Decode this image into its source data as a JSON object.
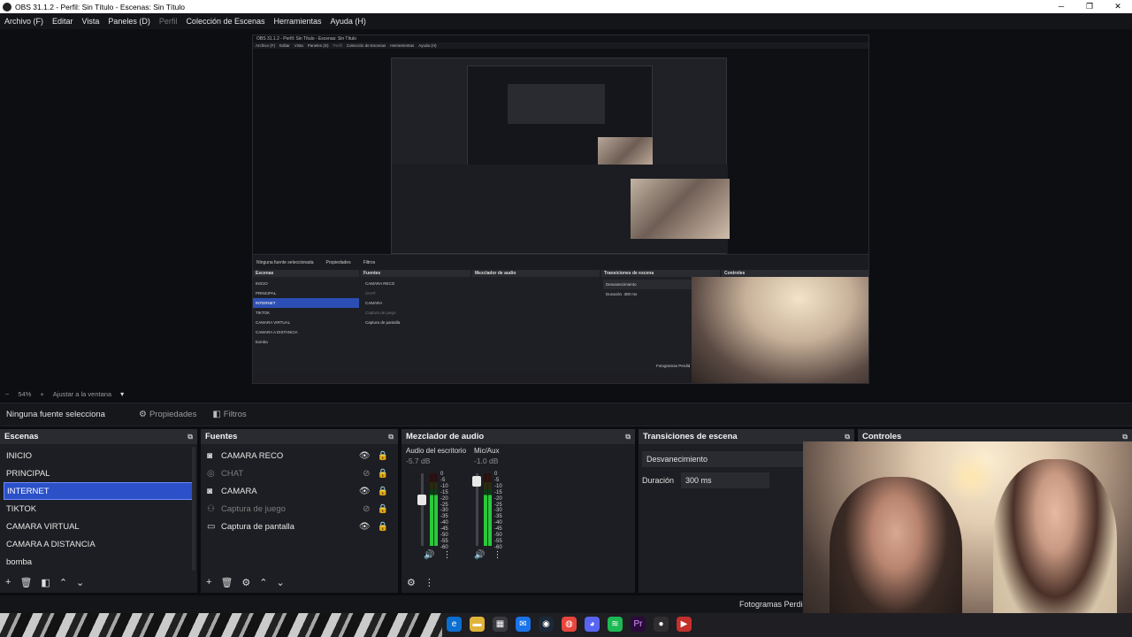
{
  "window": {
    "title": "OBS 31.1.2 - Perfil: Sin Título - Escenas: Sin Título"
  },
  "menu": [
    {
      "label": "Archivo (F)",
      "enabled": true
    },
    {
      "label": "Editar",
      "enabled": true
    },
    {
      "label": "Vista",
      "enabled": true
    },
    {
      "label": "Paneles (D)",
      "enabled": true
    },
    {
      "label": "Perfil",
      "enabled": false
    },
    {
      "label": "Colección de Escenas",
      "enabled": true
    },
    {
      "label": "Herramientas",
      "enabled": true
    },
    {
      "label": "Ayuda (H)",
      "enabled": true
    }
  ],
  "nested": {
    "title": "OBS 31.1.2 - Perfil: Sin Título - Escenas: Sin Título",
    "menu": [
      "Archivo (F)",
      "Editar",
      "Vista",
      "Paneles (D)",
      "Perfil",
      "Colección de Escenas",
      "Herramientas",
      "Ayuda (H)"
    ],
    "no_source": "Ninguna fuente seleccionada",
    "properties": "Propiedades",
    "filters": "Filtros",
    "zoom": "54%",
    "fit": "Ajustar a la ventana",
    "docks": [
      "Escenas",
      "Fuentes",
      "Mezclador de audio",
      "Transiciones de escena",
      "Controles"
    ],
    "scenes": [
      "INICIO",
      "PRINCIPAL",
      "INTERNET",
      "TIKTOK",
      "CAMARA VIRTUAL",
      "CAMARA A DISTANCIA",
      "bomba"
    ],
    "sources": [
      "CAMARA RECO",
      "CHAT",
      "CAMARA",
      "Captura de juego",
      "Captura de pantalla"
    ],
    "transition": "Desvanecimiento",
    "duration_label": "Duración",
    "duration": "300 ms",
    "frames": "Fotogramas Perdid"
  },
  "zoom": {
    "value": "54%",
    "fit_label": "Ajustar a la ventana"
  },
  "source_bar": {
    "no_source": "Ninguna fuente selecciona",
    "properties": "Propiedades",
    "filters": "Filtros"
  },
  "scenes": {
    "title": "Escenas",
    "items": [
      "INICIO",
      "PRINCIPAL",
      "INTERNET",
      "TIKTOK",
      "CAMARA VIRTUAL",
      "CAMARA A DISTANCIA",
      "bomba"
    ],
    "selected_index": 2
  },
  "sources": {
    "title": "Fuentes",
    "items": [
      {
        "name": "CAMARA RECO",
        "icon": "camera-icon",
        "visible": true
      },
      {
        "name": "CHAT",
        "icon": "globe-icon",
        "visible": false
      },
      {
        "name": "CAMARA",
        "icon": "camera-icon",
        "visible": true
      },
      {
        "name": "Captura de juego",
        "icon": "gamepad-icon",
        "visible": false
      },
      {
        "name": "Captura de pantalla",
        "icon": "monitor-icon",
        "visible": true
      }
    ]
  },
  "mixer": {
    "title": "Mezclador de audio",
    "channels": [
      {
        "name": "Audio del escritorio",
        "db": "-5.7 dB",
        "level": 0.82
      },
      {
        "name": "Mic/Aux",
        "db": "-1.0 dB",
        "level": 0.98
      }
    ],
    "scale": [
      "0",
      "-5",
      "-10",
      "-15",
      "-20",
      "-25",
      "-30",
      "-35",
      "-40",
      "-45",
      "-50",
      "-55",
      "-60"
    ]
  },
  "transitions": {
    "title": "Transiciones de escena",
    "selected": "Desvanecimiento",
    "duration_label": "Duración",
    "duration": "300 ms"
  },
  "controls": {
    "title": "Controles"
  },
  "status": {
    "frames": "Fotogramas Perdid"
  },
  "colors": {
    "accent": "#2b50c8",
    "panel": "#1d1e23",
    "header": "#2a2b31",
    "meter_green": "#29c93b"
  }
}
